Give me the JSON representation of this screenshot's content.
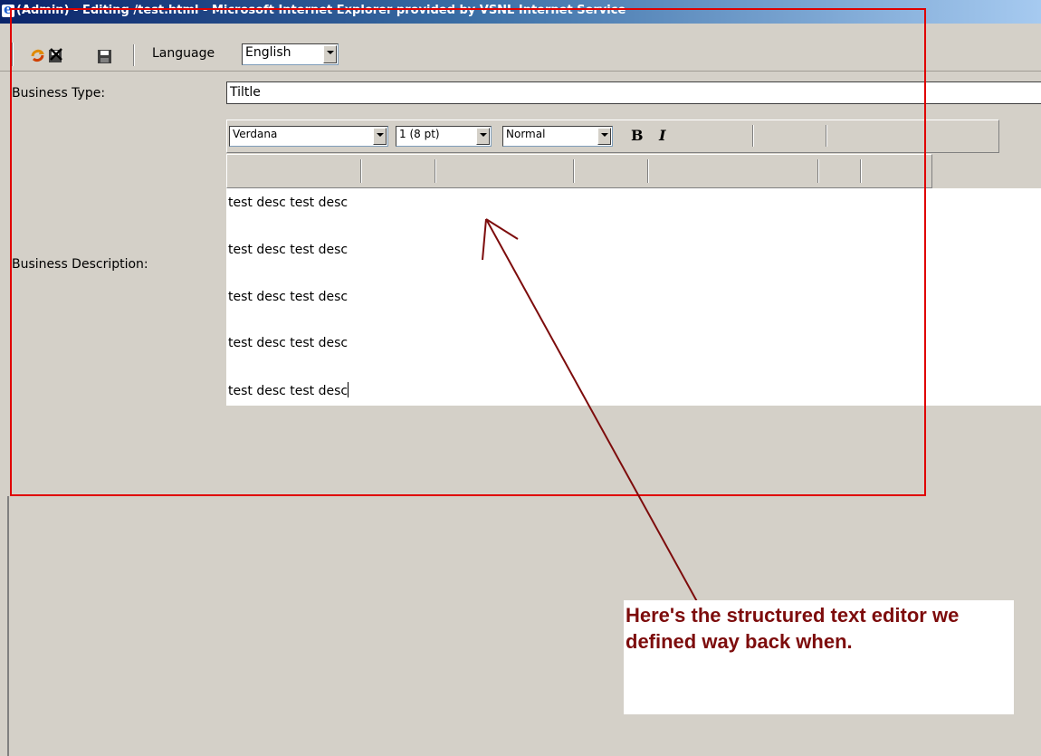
{
  "window": {
    "title": "(Admin) - Editing /test.html - Microsoft Internet Explorer provided by VSNL Internet Service"
  },
  "toolbar": {
    "icons": [
      "refresh-icon",
      "delete-icon",
      "save-icon"
    ],
    "language_label": "Language",
    "language_value": "English"
  },
  "form": {
    "business_type_label": "Business Type:",
    "business_type_value": "Tiltle",
    "business_description_label": "Business Description:"
  },
  "editor_toolbar": {
    "font_family": "Verdana",
    "font_size": "1 (8 pt)",
    "paragraph_style": "Normal",
    "bold_label": "B",
    "italic_label": "I"
  },
  "editor": {
    "paragraphs": [
      "test desc test desc",
      "test desc test desc",
      "test desc test desc",
      "test desc test desc",
      "test desc test desc"
    ]
  },
  "annotation": {
    "text": "Here's the structured text editor we defined way back when.",
    "highlight_color": "#e00000",
    "text_color": "#7d0c0c"
  }
}
